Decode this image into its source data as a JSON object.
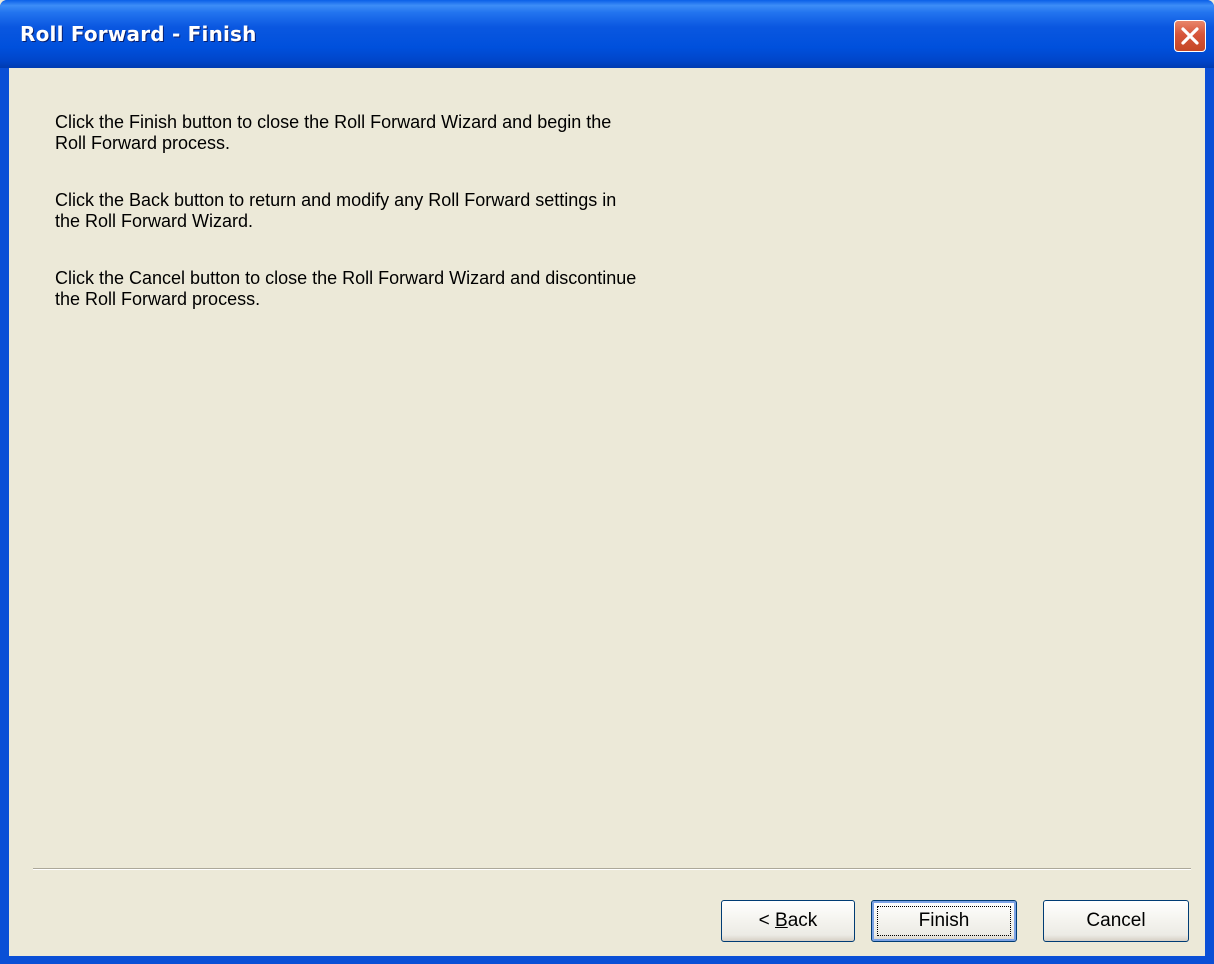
{
  "window": {
    "title": "Roll Forward - Finish"
  },
  "titlebar": {
    "close_icon": "close-x-icon"
  },
  "content": {
    "paragraphs": [
      {
        "line1": "Click the Finish button to close the Roll Forward Wizard and begin the",
        "line2": "Roll Forward process."
      },
      {
        "line1": "Click the Back button to return and modify any Roll Forward settings in",
        "line2": "the Roll Forward Wizard."
      },
      {
        "line1": "Click the Cancel button to close the Roll Forward Wizard and discontinue",
        "line2": "the Roll Forward process."
      }
    ]
  },
  "buttons": {
    "back_prefix": "< ",
    "back_mnemonic": "B",
    "back_rest": "ack",
    "finish_label": "Finish",
    "cancel_label": "Cancel"
  },
  "colors": {
    "titlebar": "#0050dc",
    "client_background": "#ece9d8",
    "close_button": "#d7553a"
  }
}
